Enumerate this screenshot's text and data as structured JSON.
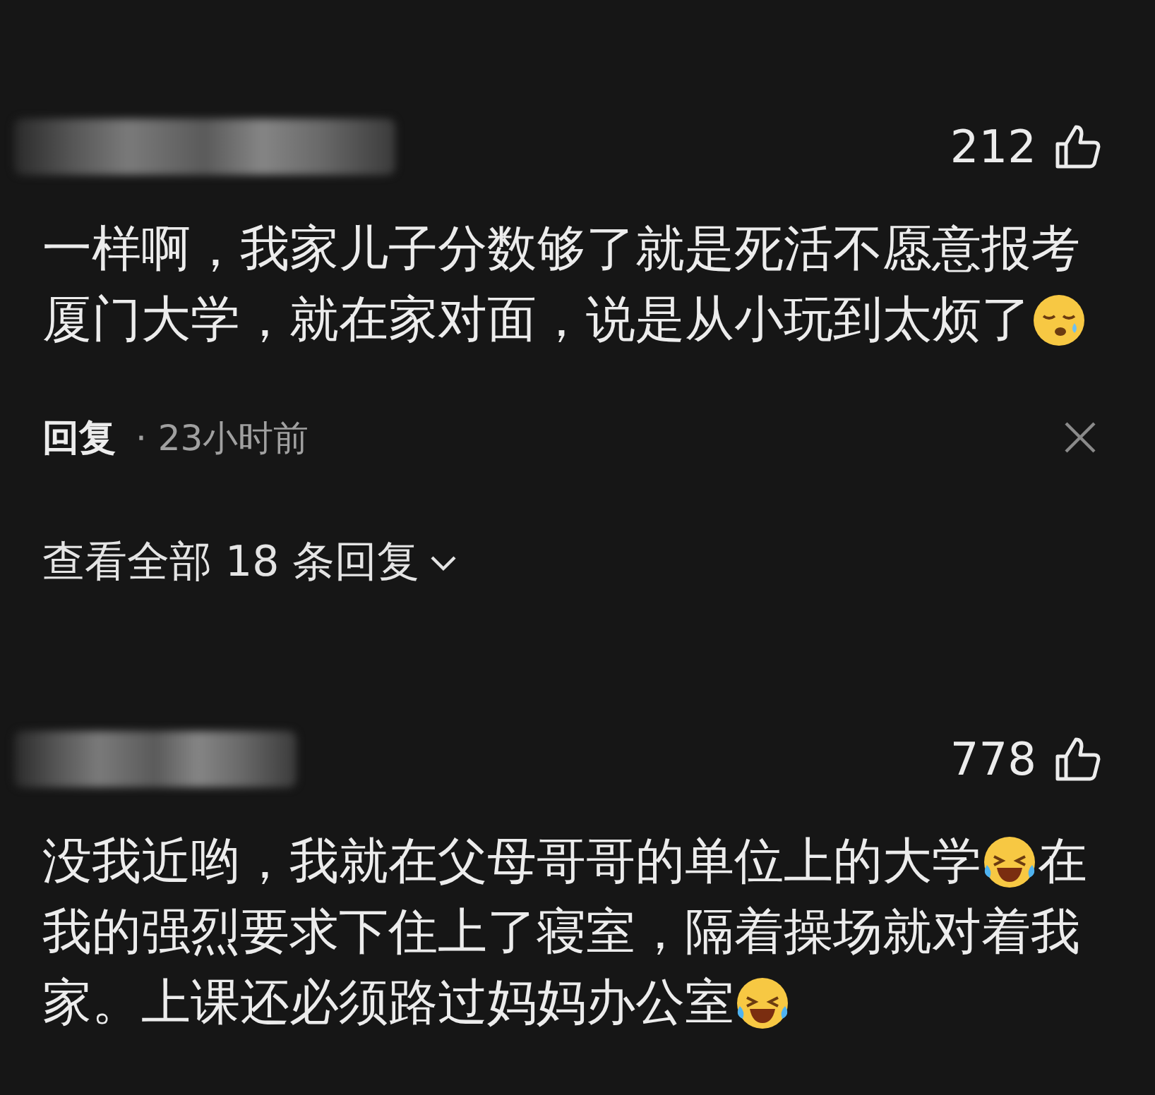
{
  "comments": [
    {
      "likes": "212",
      "lines": [
        [
          {
            "kind": "text",
            "text": "一样啊，我家儿子分数够了就是死活不愿意报考"
          }
        ],
        [
          {
            "kind": "text",
            "text": "厦门大学，就在家对面，说是从小玩到太烦了"
          },
          {
            "kind": "tired"
          }
        ]
      ],
      "reply_label": "回复",
      "time": "· 23小时前",
      "view_replies": "查看全部 18 条回复"
    },
    {
      "likes": "778",
      "lines": [
        [
          {
            "kind": "text",
            "text": "没我近哟，我就在父母哥哥的单位上的大学"
          },
          {
            "kind": "laughing"
          },
          {
            "kind": "text",
            "text": "在"
          }
        ],
        [
          {
            "kind": "text",
            "text": "我的强烈要求下住上了寝室，隔着操场就对着我"
          }
        ],
        [
          {
            "kind": "text",
            "text": "家。上课还必须路过妈妈办公室"
          },
          {
            "kind": "laughing"
          }
        ]
      ]
    }
  ]
}
